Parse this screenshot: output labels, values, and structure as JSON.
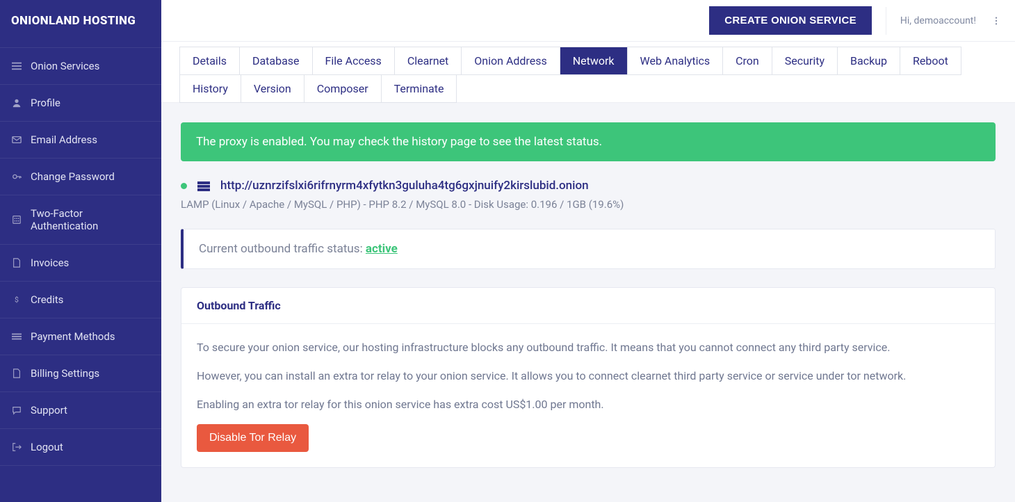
{
  "brand": "ONIONLAND HOSTING",
  "sidebar": {
    "items": [
      {
        "label": "Onion Services",
        "icon": "list-icon"
      },
      {
        "label": "Profile",
        "icon": "user-icon"
      },
      {
        "label": "Email Address",
        "icon": "envelope-icon"
      },
      {
        "label": "Change Password",
        "icon": "key-icon"
      },
      {
        "label": "Two-Factor Authentication",
        "icon": "keypad-icon"
      },
      {
        "label": "Invoices",
        "icon": "file-icon"
      },
      {
        "label": "Credits",
        "icon": "dollar-icon"
      },
      {
        "label": "Payment Methods",
        "icon": "list2-icon"
      },
      {
        "label": "Billing Settings",
        "icon": "file2-icon"
      },
      {
        "label": "Support",
        "icon": "chat-icon"
      },
      {
        "label": "Logout",
        "icon": "logout-icon"
      }
    ]
  },
  "header": {
    "create_label": "CREATE ONION SERVICE",
    "greeting": "Hi, demoaccount!"
  },
  "tabs": [
    {
      "label": "Details",
      "active": false
    },
    {
      "label": "Database",
      "active": false
    },
    {
      "label": "File Access",
      "active": false
    },
    {
      "label": "Clearnet",
      "active": false
    },
    {
      "label": "Onion Address",
      "active": false
    },
    {
      "label": "Network",
      "active": true
    },
    {
      "label": "Web Analytics",
      "active": false
    },
    {
      "label": "Cron",
      "active": false
    },
    {
      "label": "Security",
      "active": false
    },
    {
      "label": "Backup",
      "active": false
    },
    {
      "label": "Reboot",
      "active": false
    },
    {
      "label": "History",
      "active": false
    },
    {
      "label": "Version",
      "active": false
    },
    {
      "label": "Composer",
      "active": false
    },
    {
      "label": "Terminate",
      "active": false
    }
  ],
  "alert": "The proxy is enabled. You may check the history page to see the latest status.",
  "service": {
    "url": "http://uznrzifslxi6rifrnyrm4xfytkn3guluha4tg6gxjnuify2kirslubid.onion",
    "meta": "LAMP (Linux / Apache / MySQL / PHP) - PHP 8.2 / MySQL 8.0 - Disk Usage: 0.196 / 1GB (19.6%)"
  },
  "status_card": {
    "prefix": "Current outbound traffic status: ",
    "value": "active"
  },
  "outbound": {
    "title": "Outbound Traffic",
    "p1": "To secure your onion service, our hosting infrastructure blocks any outbound traffic. It means that you cannot connect any third party service.",
    "p2": "However, you can install an extra tor relay to your onion service. It allows you to connect clearnet third party service or service under tor network.",
    "p3": "Enabling an extra tor relay for this onion service has extra cost US$1.00 per month.",
    "button": "Disable Tor Relay"
  }
}
